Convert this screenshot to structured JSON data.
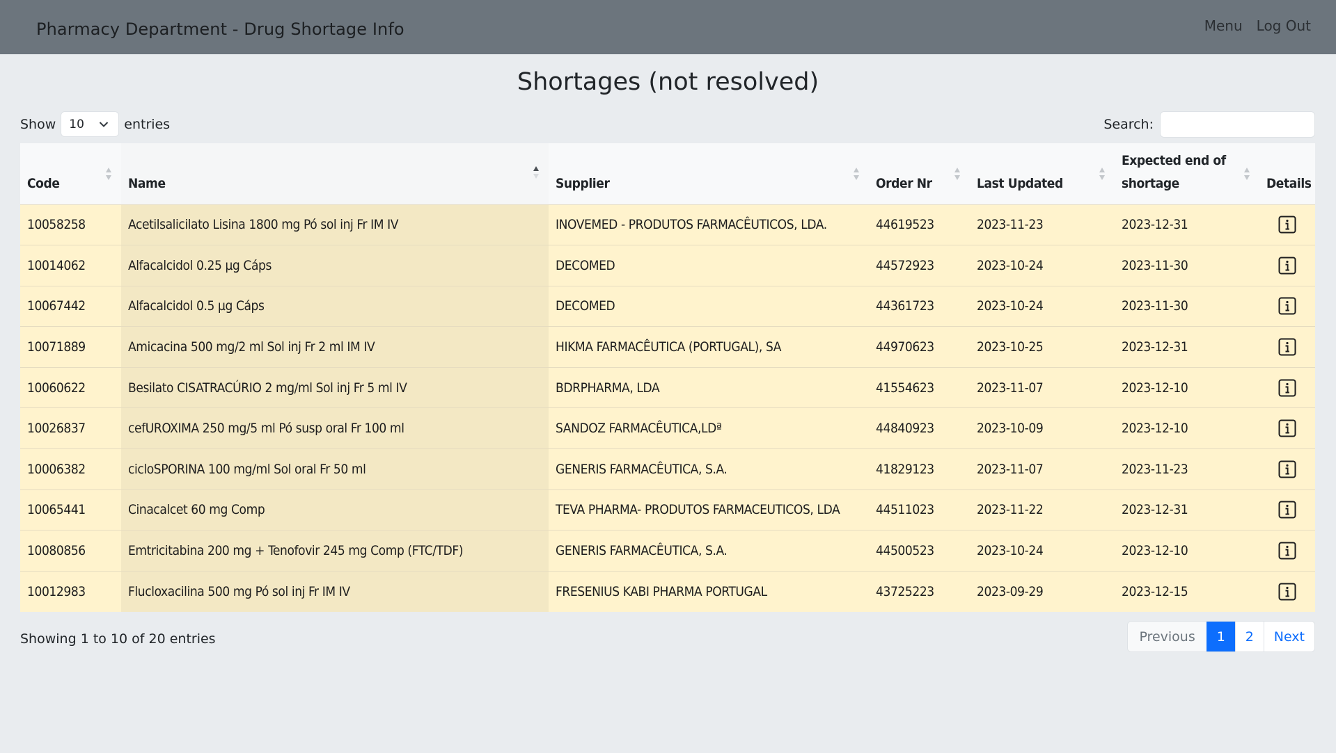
{
  "navbar": {
    "brand": "Pharmacy Department - Drug Shortage Info",
    "links": [
      "Menu",
      "Log Out"
    ],
    "bg_color": "#6c757d"
  },
  "page": {
    "title": "Shortages (not resolved)"
  },
  "length": {
    "show_label": "Show",
    "value": "10",
    "entries_label": "entries"
  },
  "search": {
    "label": "Search:",
    "value": "",
    "placeholder": ""
  },
  "table": {
    "columns": [
      "Code",
      "Name",
      "Supplier",
      "Order Nr",
      "Last Updated",
      "Expected end of shortage",
      "Details"
    ],
    "sorted_column": "Name",
    "sort_direction": "ascending",
    "row_color": "#fff3cd",
    "detail_icon": "info-icon",
    "rows": [
      {
        "code": "10058258",
        "name": "Acetilsalicilato Lisina 1800 mg Pó sol inj Fr IM IV",
        "supplier": "INOVEMED - PRODUTOS FARMACÊUTICOS, LDA.",
        "order": "44619523",
        "updated": "2023-11-23",
        "expected": "2023-12-31"
      },
      {
        "code": "10014062",
        "name": "Alfacalcidol 0.25 µg Cáps",
        "supplier": "DECOMED",
        "order": "44572923",
        "updated": "2023-10-24",
        "expected": "2023-11-30"
      },
      {
        "code": "10067442",
        "name": "Alfacalcidol 0.5 µg Cáps",
        "supplier": "DECOMED",
        "order": "44361723",
        "updated": "2023-10-24",
        "expected": "2023-11-30"
      },
      {
        "code": "10071889",
        "name": "Amicacina 500 mg/2 ml Sol inj Fr 2 ml IM IV",
        "supplier": "HIKMA FARMACÊUTICA (PORTUGAL), SA",
        "order": "44970623",
        "updated": "2023-10-25",
        "expected": "2023-12-31"
      },
      {
        "code": "10060622",
        "name": "Besilato CISATRACÚRIO 2 mg/ml Sol inj Fr 5 ml IV",
        "supplier": "BDRPHARMA, LDA",
        "order": "41554623",
        "updated": "2023-11-07",
        "expected": "2023-12-10"
      },
      {
        "code": "10026837",
        "name": "cefUROXIMA 250 mg/5 ml Pó susp oral Fr 100 ml",
        "supplier": "SANDOZ FARMACÊUTICA,LDª",
        "order": "44840923",
        "updated": "2023-10-09",
        "expected": "2023-12-10"
      },
      {
        "code": "10006382",
        "name": "cicloSPORINA 100 mg/ml Sol oral Fr 50 ml",
        "supplier": "GENERIS FARMACÊUTICA, S.A.",
        "order": "41829123",
        "updated": "2023-11-07",
        "expected": "2023-11-23"
      },
      {
        "code": "10065441",
        "name": "Cinacalcet 60 mg Comp",
        "supplier": "TEVA PHARMA- PRODUTOS FARMACEUTICOS, LDA",
        "order": "44511023",
        "updated": "2023-11-22",
        "expected": "2023-12-31"
      },
      {
        "code": "10080856",
        "name": "Emtricitabina 200 mg + Tenofovir 245 mg Comp (FTC/TDF)",
        "supplier": "GENERIS FARMACÊUTICA, S.A.",
        "order": "44500523",
        "updated": "2023-10-24",
        "expected": "2023-12-10"
      },
      {
        "code": "10012983",
        "name": "Flucloxacilina 500 mg Pó sol inj Fr IM IV",
        "supplier": "FRESENIUS KABI PHARMA PORTUGAL",
        "order": "43725223",
        "updated": "2023-09-29",
        "expected": "2023-12-15"
      }
    ]
  },
  "footer": {
    "info": "Showing 1 to 10 of 20 entries",
    "pagination": {
      "previous": "Previous",
      "pages": [
        "1",
        "2"
      ],
      "current": "1",
      "next": "Next"
    }
  }
}
